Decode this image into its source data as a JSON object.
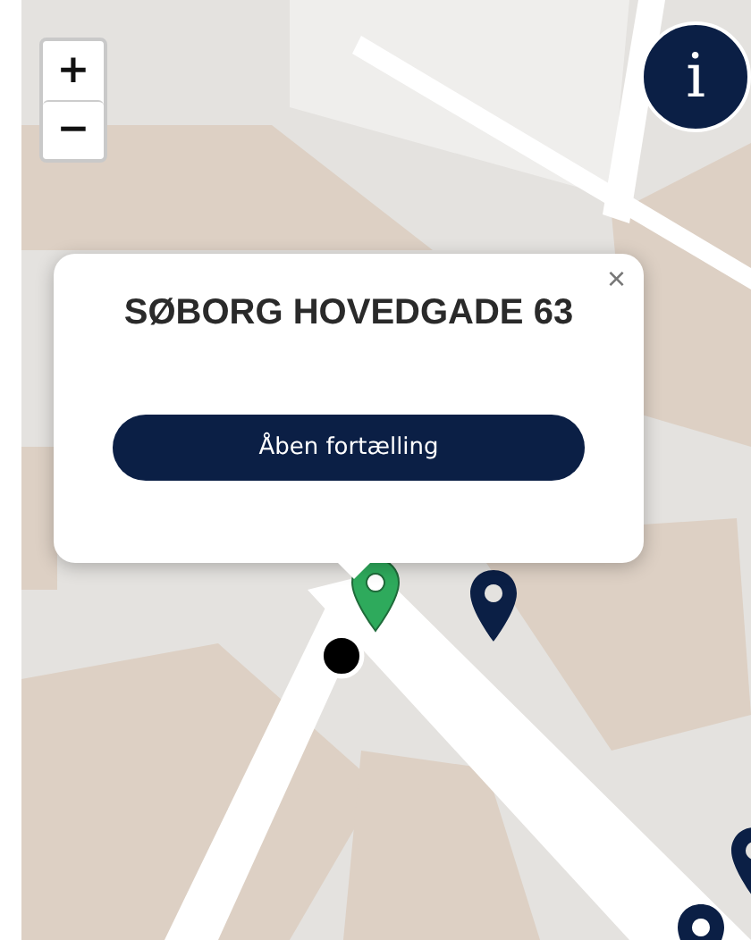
{
  "zoom_controls": {
    "zoom_in": "+",
    "zoom_out": "−"
  },
  "info_button": {
    "label": "i"
  },
  "markers": [
    {
      "selected": true
    },
    {
      "selected": false
    },
    {
      "selected": false
    },
    {
      "selected": false
    }
  ],
  "popup": {
    "title": "SØBORG HOVEDGADE 63",
    "close": "×",
    "button": "Åben fortælling"
  }
}
